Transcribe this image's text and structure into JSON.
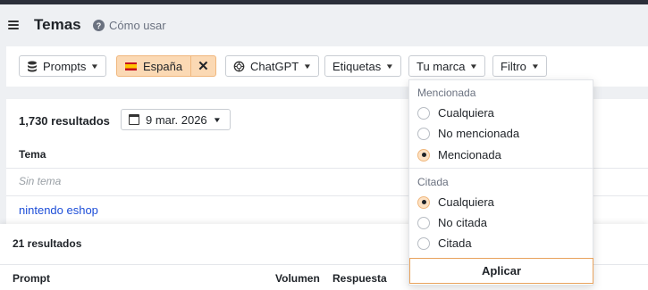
{
  "header": {
    "title": "Temas",
    "help_label": "Cómo usar",
    "help_glyph": "?"
  },
  "filters": {
    "prompts": "Prompts",
    "country": "España",
    "remove_glyph": "✕",
    "model": "ChatGPT",
    "tags": "Etiquetas",
    "brand": "Tu marca",
    "filter": "Filtro",
    "chevron": "▼"
  },
  "topics": {
    "results": "1,730 resultados",
    "date": "9 mar. 2026",
    "column_topic": "Tema",
    "rows": [
      "Sin tema",
      "nintendo eshop"
    ]
  },
  "prompts_table": {
    "results": "21 resultados",
    "columns": [
      "Prompt",
      "Volumen",
      "Respuesta"
    ]
  },
  "brand_dropdown": {
    "mentioned_label": "Mencionada",
    "mentioned_options": [
      {
        "label": "Cualquiera",
        "selected": false
      },
      {
        "label": "No mencionada",
        "selected": false
      },
      {
        "label": "Mencionada",
        "selected": true
      }
    ],
    "cited_label": "Citada",
    "cited_options": [
      {
        "label": "Cualquiera",
        "selected": true
      },
      {
        "label": "No citada",
        "selected": false
      },
      {
        "label": "Citada",
        "selected": false
      }
    ],
    "apply": "Aplicar"
  },
  "colors": {
    "accent": "#fbd9b4",
    "accent_border": "#f0b77d",
    "link": "#1d4ed8"
  }
}
